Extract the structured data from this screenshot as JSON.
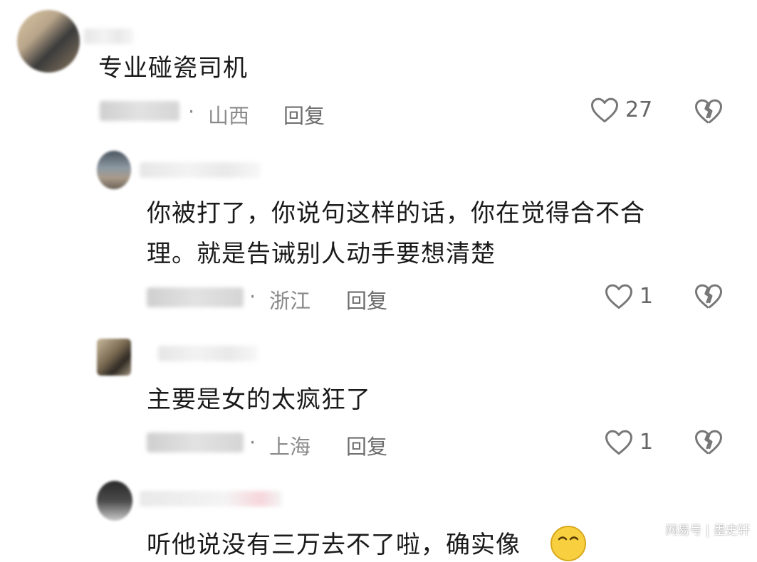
{
  "comments": [
    {
      "text": "专业碰瓷司机",
      "location": "山西",
      "reply_label": "回复",
      "likes": "27"
    },
    {
      "text_line1": "你被打了，你说句这样的话，你在觉得合不合",
      "text_line2": "理。就是告诫别人动手要想清楚",
      "location": "浙江",
      "reply_label": "回复",
      "likes": "1"
    },
    {
      "text": "主要是女的太疯狂了",
      "location": "上海",
      "reply_label": "回复",
      "likes": "1"
    },
    {
      "text_partial": "听他说没有三万去不了啦，确实像"
    }
  ],
  "separator": "·",
  "watermark": "网易号 | 墨史轩",
  "icons": {
    "like": "heart-outline-icon",
    "dislike": "broken-heart-icon",
    "emoji": "laughing-emoji-icon"
  },
  "colors": {
    "text": "#1a1a1a",
    "meta": "#8a8a8a",
    "icon": "#777777"
  }
}
